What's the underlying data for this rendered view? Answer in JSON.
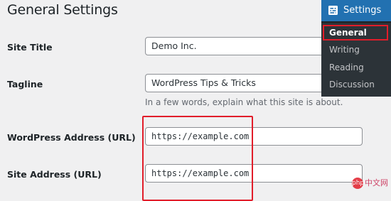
{
  "page": {
    "title": "General Settings"
  },
  "fields": {
    "site_title": {
      "label": "Site Title",
      "value": "Demo Inc."
    },
    "tagline": {
      "label": "Tagline",
      "value": "WordPress Tips & Tricks",
      "description": "In a few words, explain what this site is about."
    },
    "wordpress_address": {
      "label": "WordPress Address (URL)",
      "value": "https://example.com"
    },
    "site_address": {
      "label": "Site Address (URL)",
      "value": "https://example.com"
    }
  },
  "admin_menu": {
    "heading": "Settings",
    "items": [
      {
        "label": "General",
        "current": true
      },
      {
        "label": "Writing",
        "current": false
      },
      {
        "label": "Reading",
        "current": false
      },
      {
        "label": "Discussion",
        "current": false
      }
    ]
  },
  "colors": {
    "accent": "#2271b1",
    "highlight": "#e11d2a",
    "menu_bg": "#1d2327"
  },
  "watermark": {
    "text": "中文网"
  }
}
